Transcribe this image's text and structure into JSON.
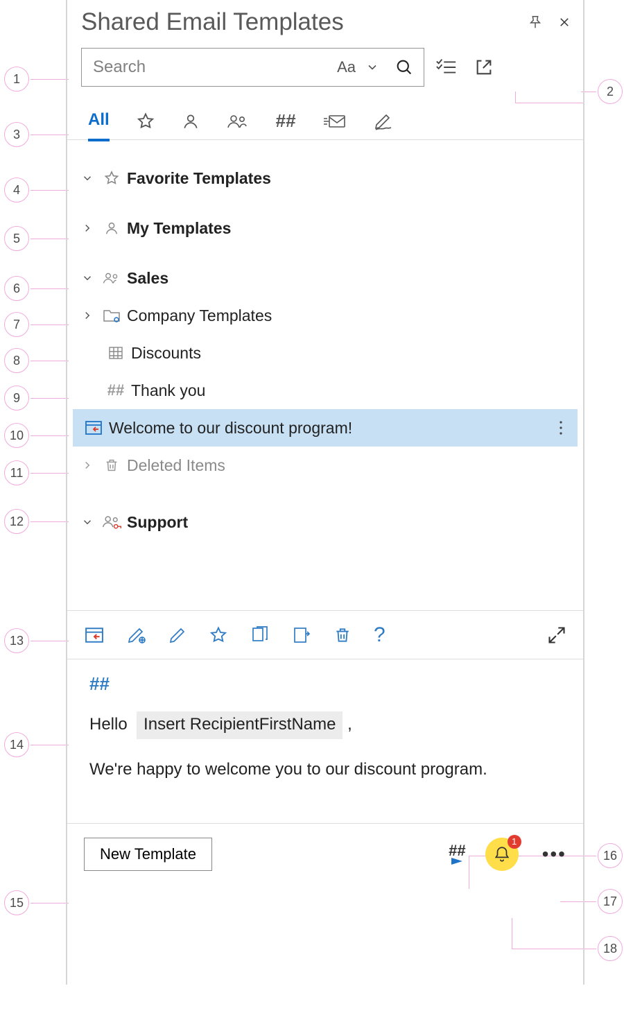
{
  "header": {
    "title": "Shared Email Templates"
  },
  "search": {
    "placeholder": "Search",
    "aa_label": "Aa"
  },
  "tabs": {
    "all_label": "All"
  },
  "tree": {
    "favorite": {
      "label": "Favorite Templates"
    },
    "my": {
      "label": "My Templates"
    },
    "sales": {
      "label": "Sales",
      "children": {
        "company": "Company Templates",
        "discounts": "Discounts",
        "thankyou": "Thank you",
        "welcome": "Welcome to our discount program!",
        "deleted": "Deleted Items"
      }
    },
    "support": {
      "label": "Support"
    }
  },
  "preview": {
    "macro_head": "##",
    "hello": "Hello",
    "insert_macro": "Insert RecipientFirstName",
    "comma": ",",
    "body": "We're happy to welcome you to our discount program."
  },
  "footer": {
    "new_template": "New Template",
    "badge": "1"
  },
  "callouts": {
    "left": [
      "1",
      "2",
      "3",
      "4",
      "5",
      "6",
      "7",
      "8",
      "9",
      "10",
      "11",
      "12",
      "13",
      "14",
      "15"
    ],
    "right": {
      "r2": "2",
      "r16": "16",
      "r17": "17",
      "r18": "18"
    }
  }
}
